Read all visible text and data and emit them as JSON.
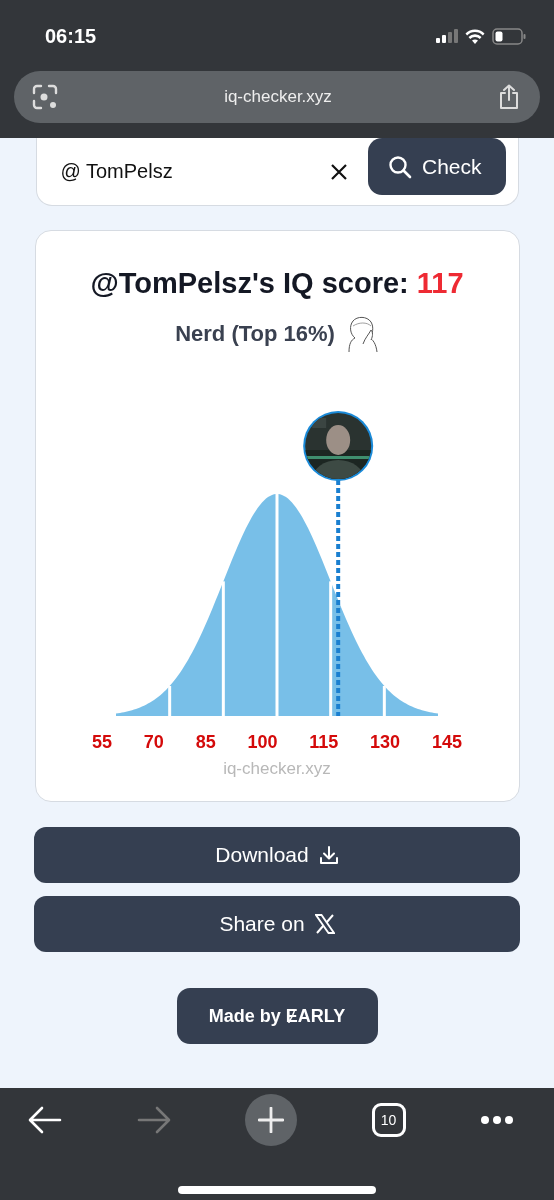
{
  "status_bar": {
    "time": "06:15"
  },
  "browser": {
    "url": "iq-checker.xyz"
  },
  "search": {
    "value": "@ TomPelsz",
    "button": "Check"
  },
  "result": {
    "title": "@TomPelsz's IQ score: ",
    "score": "117",
    "category": "Nerd (Top 16%)",
    "axis_labels": [
      "55",
      "70",
      "85",
      "100",
      "115",
      "130",
      "145"
    ],
    "watermark": "iq-checker.xyz"
  },
  "buttons": [
    {
      "kind": "download",
      "label": "Download"
    },
    {
      "kind": "share",
      "label": "Share on"
    }
  ],
  "made_by": "Made by ɆARLY",
  "toolbar": {
    "tab_count": "10",
    "forward_disabled": true
  }
}
